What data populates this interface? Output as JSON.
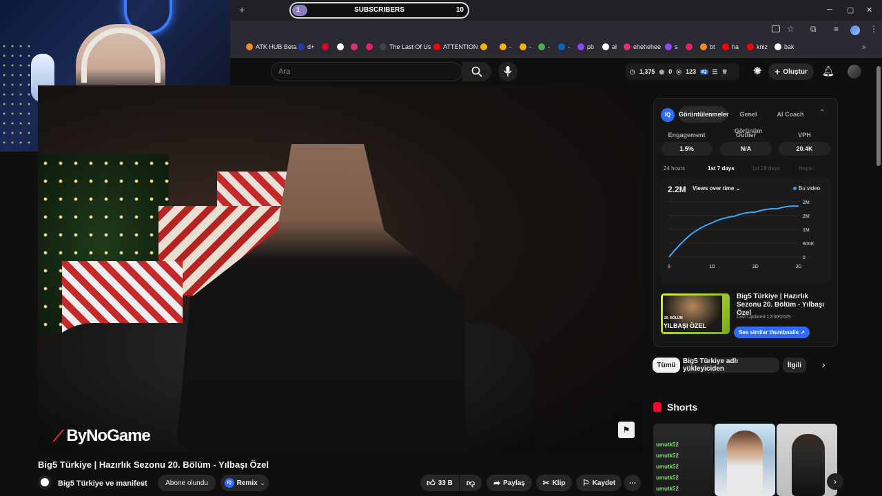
{
  "subscriber_widget": {
    "label": "SUBSCRIBERS",
    "current": "1",
    "goal": "10",
    "progress_fraction": 0.1
  },
  "window_controls": {
    "minimize": "─",
    "maximize": "▢",
    "close": "✕"
  },
  "tab_bar": {
    "new_tab": "+"
  },
  "bookmarks": [
    {
      "label": "ATK HUB Beta",
      "color": "#f28b22"
    },
    {
      "label": "d+",
      "color": "#1a3fa3"
    },
    {
      "label": "",
      "color": "#e60023"
    },
    {
      "label": "",
      "color": "#ffffff"
    },
    {
      "label": "",
      "color": "#e1306c"
    },
    {
      "label": "",
      "color": "#e91e63"
    },
    {
      "label": "The Last Of Us",
      "color": "#444444"
    },
    {
      "label": "ATTENTION",
      "color": "#ff0000"
    },
    {
      "label": "",
      "color": "#f4b400"
    },
    {
      "label": "-",
      "color": "#f4b400"
    },
    {
      "label": "-",
      "color": "#f4b400"
    },
    {
      "label": "-",
      "color": "#4caf50"
    },
    {
      "label": "-",
      "color": "#0a66c2"
    },
    {
      "label": "pb",
      "color": "#9146ff"
    },
    {
      "label": "al",
      "color": "#ffffff"
    },
    {
      "label": "ehehehee",
      "color": "#e1306c"
    },
    {
      "label": "s",
      "color": "#9146ff"
    },
    {
      "label": "",
      "color": "#e91e63"
    },
    {
      "label": "bt",
      "color": "#f28b22"
    },
    {
      "label": "ha",
      "color": "#ff0000"
    },
    {
      "label": "knlz",
      "color": "#ff0000"
    },
    {
      "label": "bak",
      "color": "#ffffff"
    }
  ],
  "search": {
    "placeholder": "Ara"
  },
  "header": {
    "stats": {
      "a": "1,375",
      "b": "0",
      "c": "123"
    },
    "create_label": "Oluştur"
  },
  "video": {
    "title": "Big5 Türkiye | Hazırlık Sezonu 20. Bölüm - Yılbaşı Özel",
    "watermark": "ByNoGame",
    "channel": "Big5 Türkiye ve manifest",
    "subscribed_label": "Abone olundu",
    "remix_label": "Remix",
    "likes": "33 B",
    "share_label": "Paylaş",
    "clip_label": "Klip",
    "save_label": "Kaydet",
    "more": "⋯"
  },
  "panel": {
    "logo": "IQ",
    "tabs": [
      "Görüntülenmeler",
      "Genel Görünüm",
      "AI Coach"
    ],
    "metrics": [
      {
        "label": "Engagement",
        "value": "1.5%"
      },
      {
        "label": "Outlier",
        "value": "N/A"
      },
      {
        "label": "VPH",
        "value": "20.4K"
      }
    ],
    "ranges": [
      "24 hours",
      "1st 7 days",
      "1st 28 days",
      "Hepsi"
    ],
    "selected_range": "1st 7 days",
    "total_views": "2.2M",
    "views_dropdown": "Views over time",
    "legend": "Bu video",
    "thumb_title": "Big5 Türkiye | Hazırlık Sezonu 20. Bölüm - Yılbaşı Özel",
    "thumb_text_top": "20. BÖLÜM",
    "thumb_text_bottom": "YILBAŞI ÖZEL",
    "last_updated": "Last Updated 12/30/2025",
    "similar_button": "See similar thumbnails"
  },
  "chart_data": {
    "type": "line",
    "x_ticks": [
      "0",
      "1D",
      "2D",
      "3D"
    ],
    "y_ticks": [
      "2M",
      "2M",
      "1M",
      "600K",
      "0"
    ],
    "series": [
      {
        "name": "Bu video",
        "x": [
          0,
          0.5,
          1,
          1.5,
          2,
          2.5,
          3
        ],
        "y": [
          0,
          0.95,
          1.45,
          1.72,
          1.9,
          2.04,
          2.15
        ]
      }
    ],
    "ylim": [
      0,
      2.45
    ],
    "xlim": [
      0,
      3
    ],
    "line_color": "#3ea6ff",
    "grid": true
  },
  "filter_chips": [
    "Tümü",
    "Big5 Türkiye adlı yükleyiciden",
    "İlgili"
  ],
  "shorts": {
    "title": "Shorts",
    "chat": [
      {
        "user": "",
        "msg": ""
      },
      {
        "user": "umutk52",
        "msg": ""
      },
      {
        "user": "umutk52",
        "msg": ""
      },
      {
        "user": "umutk52",
        "msg": ""
      },
      {
        "user": "umutk52",
        "msg": ""
      },
      {
        "user": "umutk52",
        "msg": ""
      }
    ]
  }
}
